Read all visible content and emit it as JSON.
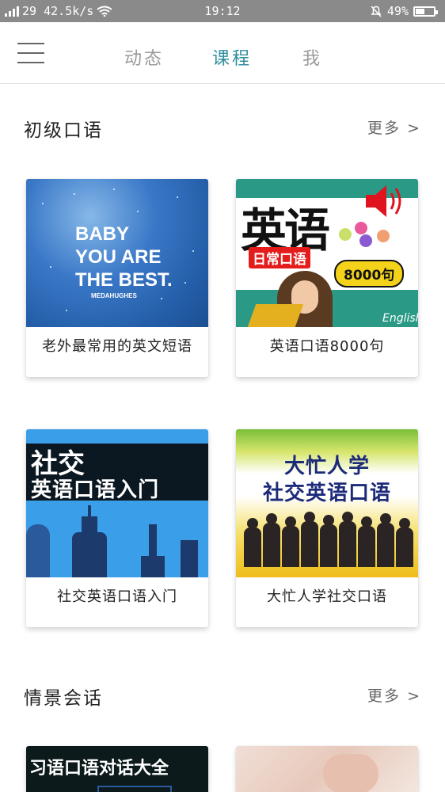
{
  "status_bar": {
    "network": "29 42.5k/s",
    "time": "19:12",
    "battery": "49%",
    "battery_level": 0.49
  },
  "nav": {
    "tabs": [
      {
        "label": "动态",
        "active": false
      },
      {
        "label": "课程",
        "active": true
      },
      {
        "label": "我",
        "active": false
      }
    ],
    "accent_color": "#2f8f9d"
  },
  "sections": [
    {
      "title": "初级口语",
      "more": "更多 >",
      "courses": [
        {
          "title": "老外最常用的英文短语",
          "cover_text": [
            "BABY",
            "YOU ARE",
            "THE BEST."
          ],
          "cover_subtext": "MEDAHUGHES"
        },
        {
          "title": "英语口语8000句",
          "cover_text": [
            "英语",
            "日常口语",
            "8000句"
          ],
          "cover_subtext": "English"
        },
        {
          "title": "社交英语口语入门",
          "cover_text": [
            "社交",
            "英语口语入门"
          ]
        },
        {
          "title": "大忙人学社交口语",
          "cover_text": [
            "大忙人学",
            "社交英语口语"
          ]
        }
      ]
    },
    {
      "title": "情景会话",
      "more": "更多 >",
      "courses": [
        {
          "cover_text": [
            "习语口语对话大全"
          ]
        },
        {}
      ]
    }
  ]
}
